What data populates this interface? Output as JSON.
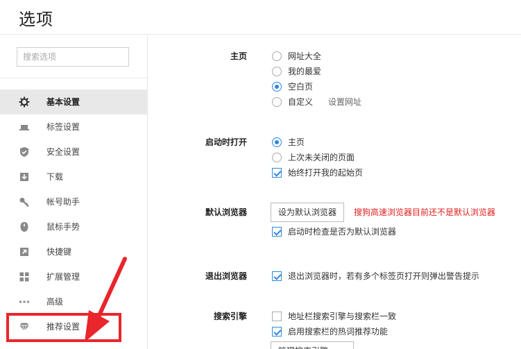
{
  "header": {
    "title": "选项"
  },
  "sidebar": {
    "search_placeholder": "搜索选项",
    "items": [
      {
        "label": "基本设置",
        "icon": "gear-icon",
        "active": true
      },
      {
        "label": "标签设置",
        "icon": "tab-icon"
      },
      {
        "label": "安全设置",
        "icon": "shield-check-icon"
      },
      {
        "label": "下载",
        "icon": "download-icon"
      },
      {
        "label": "帐号助手",
        "icon": "key-icon"
      },
      {
        "label": "鼠标手势",
        "icon": "mouse-icon"
      },
      {
        "label": "快捷键",
        "icon": "shortcut-arrow-icon"
      },
      {
        "label": "扩展管理",
        "icon": "extensions-grid-icon"
      },
      {
        "label": "高级",
        "icon": "more-dots-icon"
      },
      {
        "label": "推荐设置",
        "icon": "diamond-icon"
      }
    ]
  },
  "main": {
    "homepage": {
      "label": "主页",
      "options": [
        {
          "text": "网址大全",
          "selected": false
        },
        {
          "text": "我的最爱",
          "selected": false
        },
        {
          "text": "空白页",
          "selected": true
        },
        {
          "text": "自定义",
          "selected": false
        }
      ],
      "set_url_link": "设置网址"
    },
    "startup": {
      "label": "启动时打开",
      "options": [
        {
          "text": "主页",
          "selected": true
        },
        {
          "text": "上次未关闭的页面",
          "selected": false
        }
      ],
      "always_open": {
        "text": "始终打开我的起始页",
        "checked": true
      }
    },
    "default_browser": {
      "label": "默认浏览器",
      "button": "设为默认浏览器",
      "warning": "搜狗高速浏览器目前还不是默认浏览器",
      "check_on_start": {
        "text": "启动时检查是否为默认浏览器",
        "checked": true
      }
    },
    "exit_browser": {
      "label": "退出浏览器",
      "warn_multi_tab": {
        "text": "退出浏览器时，若有多个标签页打开则弹出警告提示",
        "checked": true
      }
    },
    "search_engine": {
      "label": "搜索引擎",
      "sync_engine": {
        "text": "地址栏搜索引擎与搜索栏一致",
        "checked": false
      },
      "hot_words": {
        "text": "启用搜索栏的热词推荐功能",
        "checked": true
      },
      "manage_button": "管理搜索引擎"
    }
  },
  "colors": {
    "accent": "#2f86e0",
    "warning": "#e0201f",
    "annotation": "#e8262b"
  }
}
